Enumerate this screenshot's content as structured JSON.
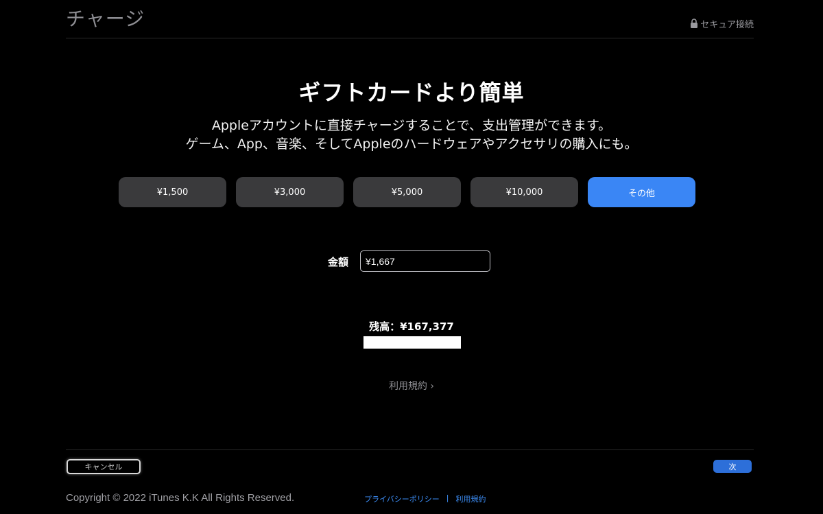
{
  "header": {
    "title": "チャージ",
    "secure_label": "セキュア接続"
  },
  "hero": {
    "headline": "ギフトカードより簡単",
    "subtitle_line1": "Appleアカウントに直接チャージすることで、支出管理ができます。",
    "subtitle_line2": "ゲーム、App、音楽、そしてAppleのハードウェアやアクセサリの購入にも。"
  },
  "amounts": [
    {
      "label": "¥1,500",
      "selected": false
    },
    {
      "label": "¥3,000",
      "selected": false
    },
    {
      "label": "¥5,000",
      "selected": false
    },
    {
      "label": "¥10,000",
      "selected": false
    },
    {
      "label": "その他",
      "selected": true
    }
  ],
  "amount_field": {
    "label": "金額",
    "value": "¥1,667"
  },
  "balance": {
    "text": "残高：¥167,377"
  },
  "terms": {
    "label": "利用規約 ›"
  },
  "actions": {
    "cancel_label": "キャンセル",
    "next_label": "次"
  },
  "footer": {
    "copyright": "Copyright © 2022 iTunes K.K All Rights Reserved.",
    "privacy_label": "プライバシーポリシー",
    "separator": "|",
    "terms_label": "利用規約"
  },
  "colors": {
    "background": "#000000",
    "button": "#3a3a3c",
    "accent": "#3a86f5",
    "link": "#3d8ef7"
  }
}
